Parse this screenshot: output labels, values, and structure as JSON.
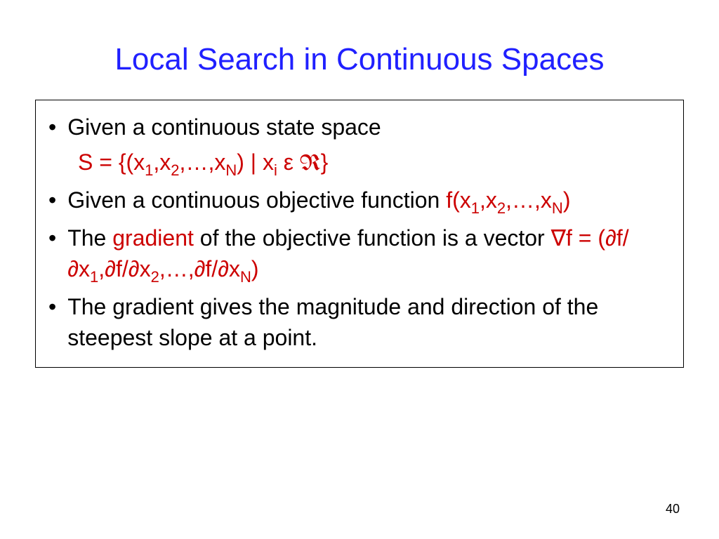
{
  "title": "Local Search in Continuous Spaces",
  "bullets": {
    "b1_text": "Given a continuous state space",
    "b1_formula_pre": "S = {(x",
    "b1_formula_s1": "1",
    "b1_formula_c1": ",x",
    "b1_formula_s2": "2",
    "b1_formula_c2": ",…,x",
    "b1_formula_s3": "N",
    "b1_formula_c3": ") | x",
    "b1_formula_s4": "i",
    "b1_formula_eps": " ε ",
    "b1_formula_R": "R",
    "b1_formula_close": "}",
    "b2_text": "Given a continuous objective function ",
    "b2_formula_pre": "f(x",
    "b2_formula_s1": "1",
    "b2_formula_c1": ",x",
    "b2_formula_s2": "2",
    "b2_formula_c2": ",…,x",
    "b2_formula_s3": "N",
    "b2_formula_close": ")",
    "b3_t1": "The ",
    "b3_grad": "gradient",
    "b3_t2": " of the objective function is a vector ",
    "b3_f_nabla": "∇f = (∂f/∂x",
    "b3_f_s1": "1",
    "b3_f_c1": ",∂f/∂x",
    "b3_f_s2": "2",
    "b3_f_c2": ",…,∂f/∂x",
    "b3_f_s3": "N",
    "b3_f_close": ")",
    "b4_text": "The gradient gives the magnitude and direction of the steepest slope at a point."
  },
  "page_number": "40"
}
